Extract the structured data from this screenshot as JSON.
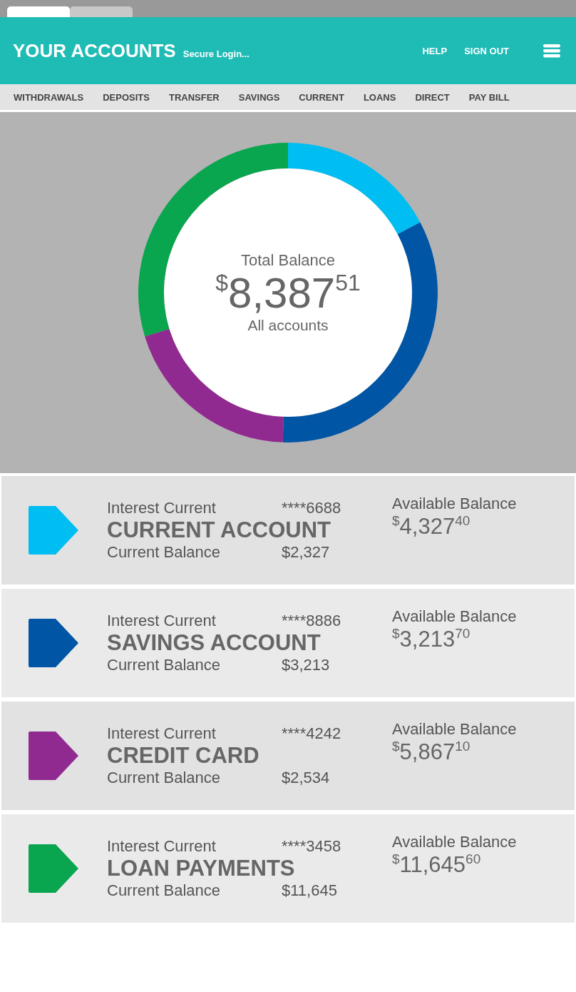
{
  "browser_tabs": [
    {
      "selected": true
    },
    {
      "selected": false
    }
  ],
  "header": {
    "title": "YOUR ACCOUNTS",
    "subtitle": "Secure Login...",
    "links": [
      "HELP",
      "SIGN OUT"
    ]
  },
  "nav": [
    "WITHDRAWALS",
    "DEPOSITS",
    "TRANSFER",
    "SAVINGS",
    "CURRENT",
    "LOANS",
    "DIRECT",
    "PAY BILL"
  ],
  "total": {
    "label": "Total Balance",
    "currency": "$",
    "whole": "8,387",
    "cents": "51",
    "caption": "All accounts"
  },
  "accounts": [
    {
      "color": "#00bdf2",
      "type_label": "Interest Current",
      "number": "****6688",
      "name": "CURRENT ACCOUNT",
      "balance_label": "Current Balance",
      "balance": "$2,327",
      "available_label": "Available Balance",
      "currency": "$",
      "whole": "4,327",
      "cents": "40"
    },
    {
      "color": "#0055a5",
      "type_label": "Interest Current",
      "number": "****8886",
      "name": "SAVINGS ACCOUNT",
      "balance_label": "Current Balance",
      "balance": "$3,213",
      "available_label": "Available Balance",
      "currency": "$",
      "whole": "3,213",
      "cents": "70"
    },
    {
      "color": "#912a90",
      "type_label": "Interest Current",
      "number": "****4242",
      "name": "CREDIT CARD",
      "balance_label": "Current Balance",
      "balance": "$2,534",
      "available_label": "Available Balance",
      "currency": "$",
      "whole": "5,867",
      "cents": "10"
    },
    {
      "color": "#0aa54f",
      "type_label": "Interest Current",
      "number": "****3458",
      "name": "LOAN PAYMENTS",
      "balance_label": "Current Balance",
      "balance": "$11,645",
      "available_label": "Available Balance",
      "currency": "$",
      "whole": "11,645",
      "cents": "60"
    }
  ]
}
